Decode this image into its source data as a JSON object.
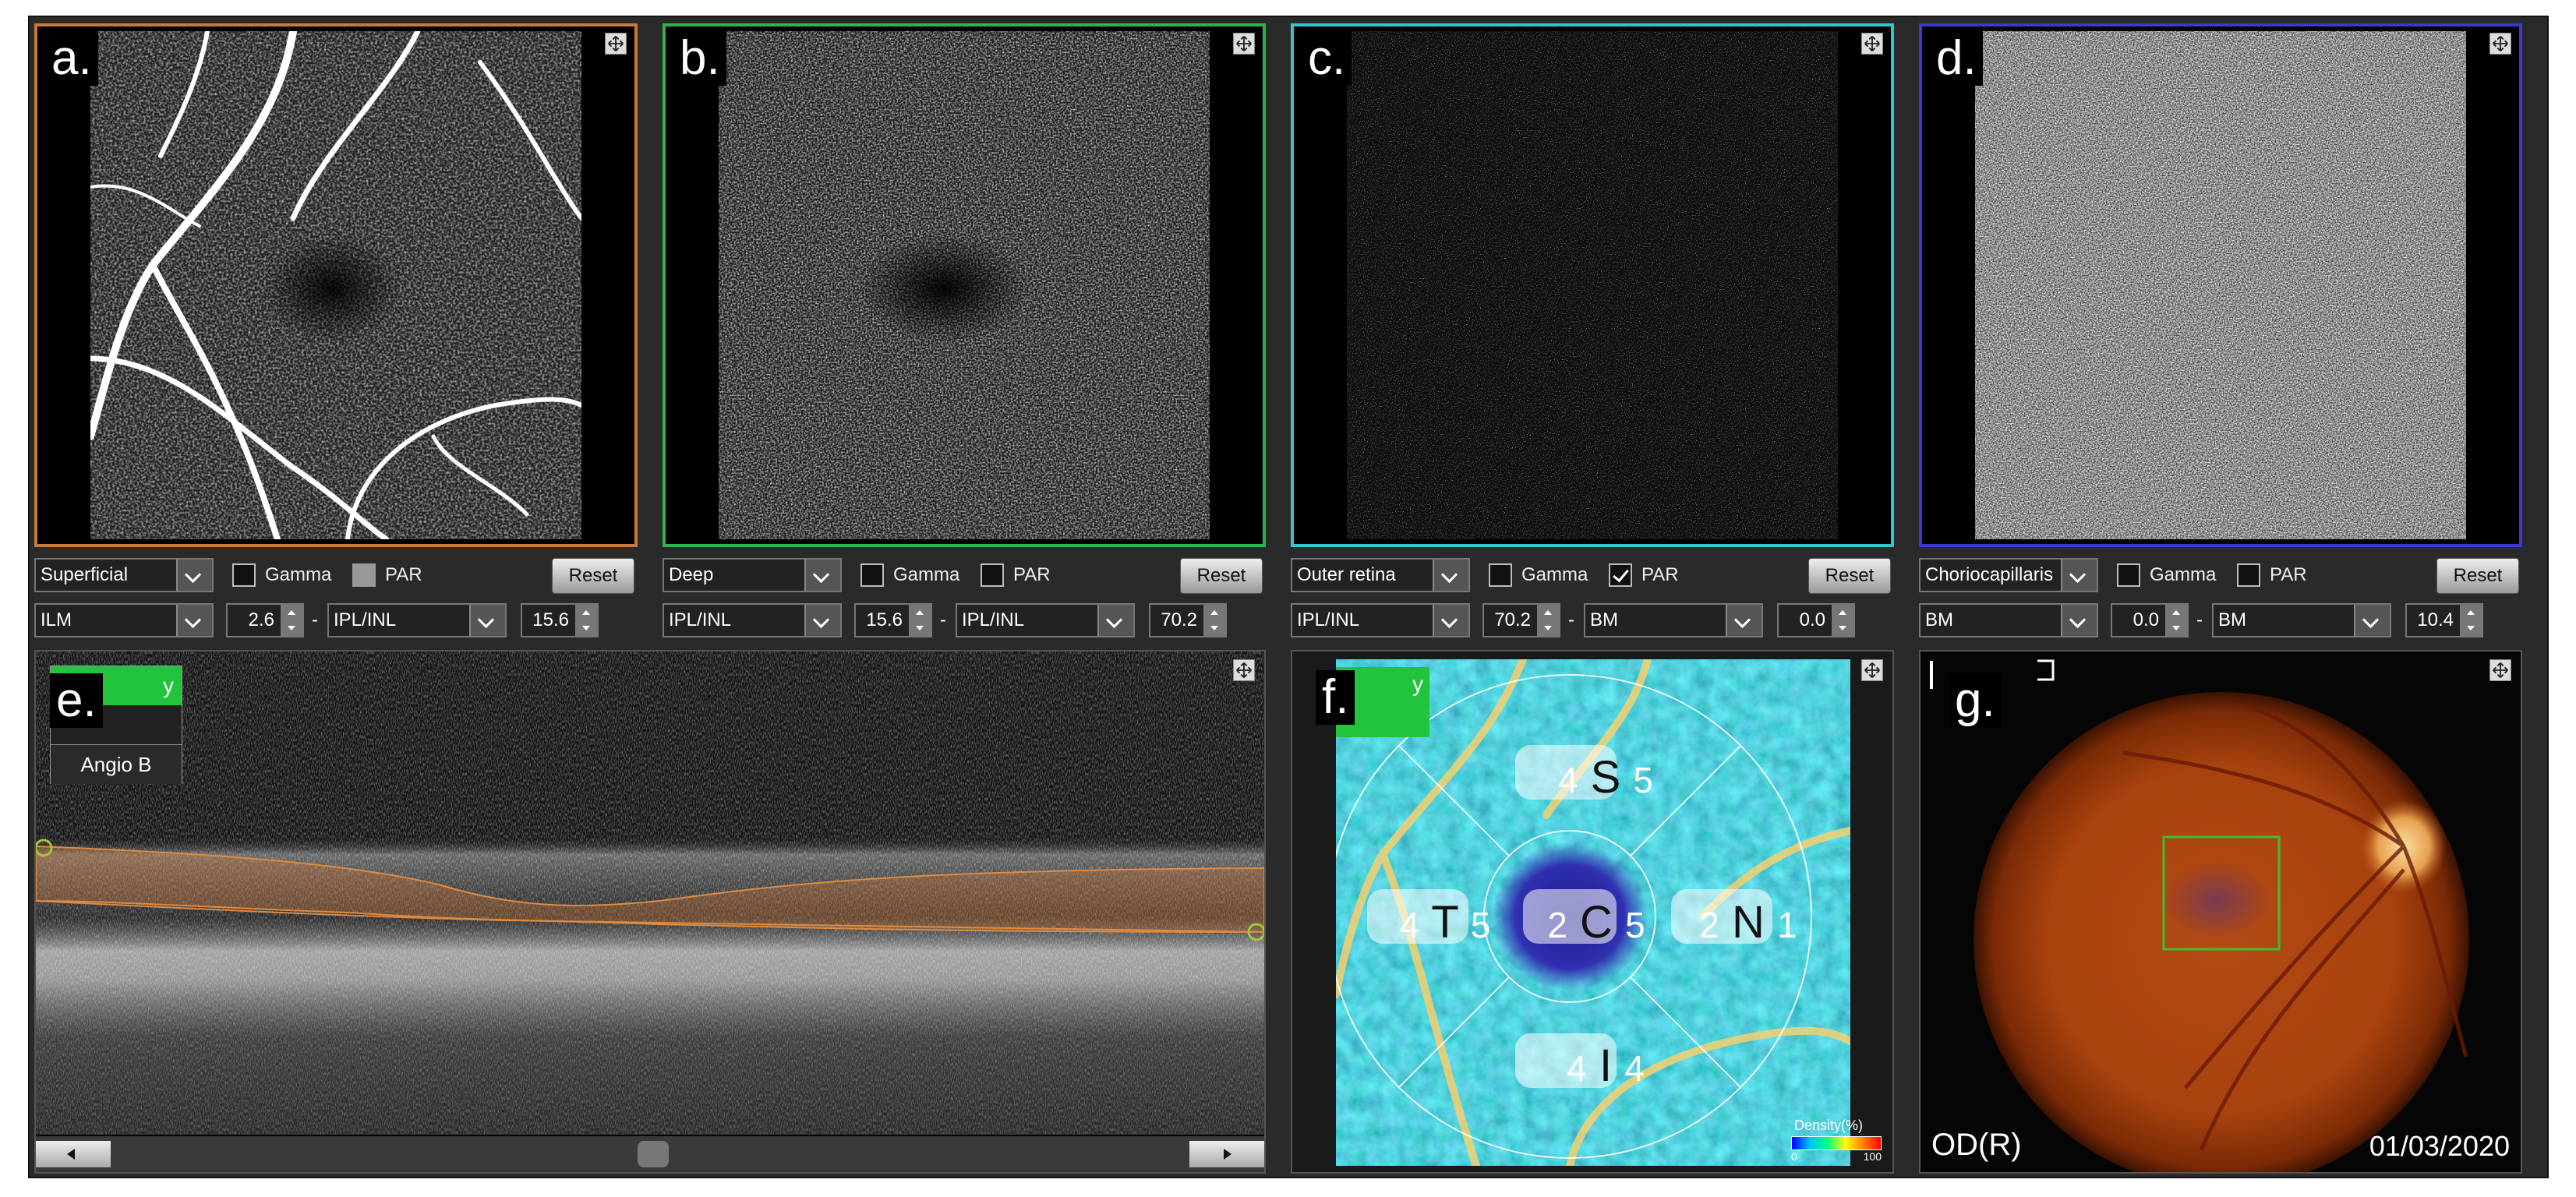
{
  "panels": {
    "a": {
      "label": "a."
    },
    "b": {
      "label": "b."
    },
    "c": {
      "label": "c."
    },
    "d": {
      "label": "d."
    },
    "e": {
      "label": "e.",
      "angio_b": "Angio B",
      "green_tab": "y"
    },
    "f": {
      "label": "f.",
      "green_tab": "y",
      "legend_title": "Density(%)",
      "legend_min": "0",
      "legend_max": "100",
      "sectors": {
        "S": "S",
        "T": "T",
        "C": "C",
        "N": "N",
        "I": "I"
      },
      "values": {
        "s_left": "4",
        "s_right": "5",
        "t_left": "4",
        "t_right": "5",
        "c_left": "2",
        "c_right": "5",
        "n_left": "2",
        "n_right": "1",
        "i_left": "4",
        "i_right": "4"
      }
    },
    "g": {
      "label": "g.",
      "eye": "OD(R)",
      "date": "01/03/2020"
    }
  },
  "controls": [
    {
      "layer": "Superficial",
      "gamma": "Gamma",
      "par": "PAR",
      "reset": "Reset",
      "top": "ILM",
      "v1": "2.6",
      "bottom": "IPL/INL",
      "v2": "15.6"
    },
    {
      "layer": "Deep",
      "gamma": "Gamma",
      "par": "PAR",
      "reset": "Reset",
      "top": "IPL/INL",
      "v1": "15.6",
      "bottom": "IPL/INL",
      "v2": "70.2"
    },
    {
      "layer": "Outer retina",
      "gamma": "Gamma",
      "par": "PAR",
      "reset": "Reset",
      "top": "IPL/INL",
      "v1": "70.2",
      "bottom": "BM",
      "v2": "0.0"
    },
    {
      "layer": "Choriocapillaris",
      "gamma": "Gamma",
      "par": "PAR",
      "reset": "Reset",
      "top": "BM",
      "v1": "0.0",
      "bottom": "BM",
      "v2": "10.4"
    }
  ],
  "colors": {
    "a": "#c8793a",
    "b": "#2fb34a",
    "c": "#36c3c9",
    "d": "#3a3acb",
    "accent_green": "#21c43c"
  }
}
